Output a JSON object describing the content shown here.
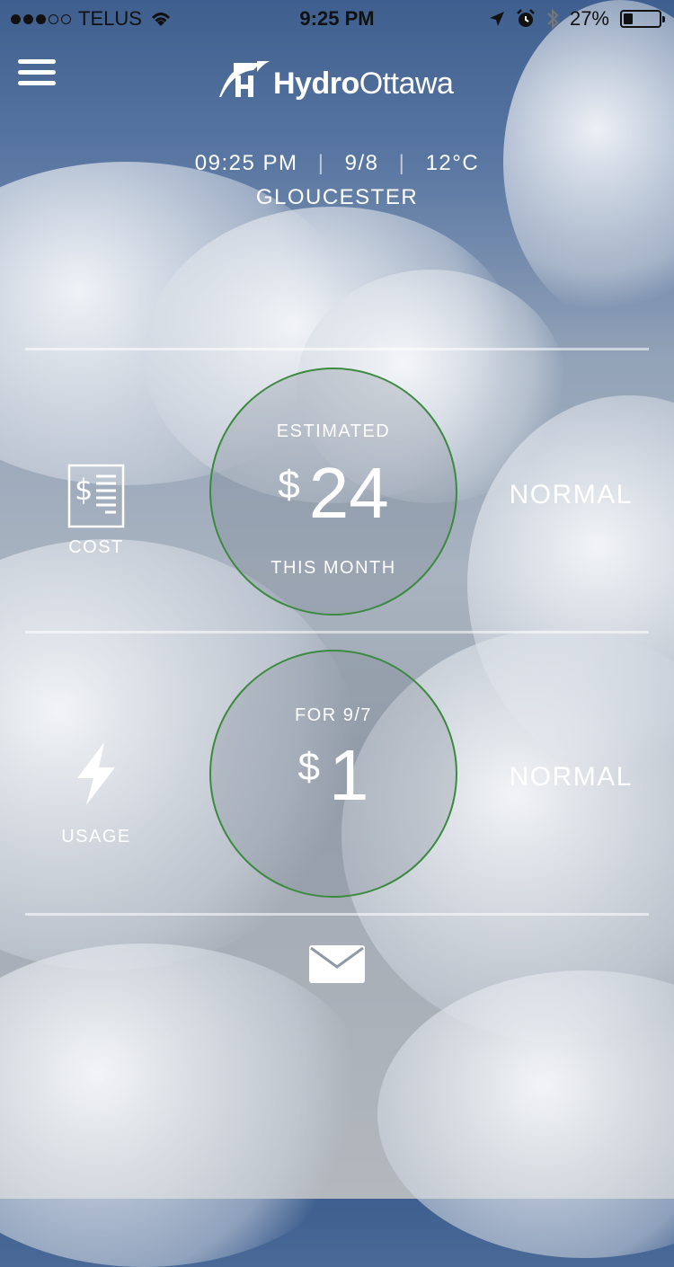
{
  "status_bar": {
    "carrier": "TELUS",
    "time": "9:25 PM",
    "battery": "27%",
    "battery_level": 0.27,
    "signal_bars_filled": 3,
    "signal_bars_total": 5
  },
  "header": {
    "logo_bold": "Hydro",
    "logo_regular": "Ottawa",
    "menu_icon": "hamburger-menu-icon"
  },
  "info": {
    "time": "09:25 PM",
    "date": "9/8",
    "temperature": "12°C",
    "city": "GLOUCESTER"
  },
  "cost": {
    "icon": "bill-icon",
    "label": "COST",
    "top_text": "ESTIMATED",
    "currency": "$",
    "amount": "24",
    "bottom_text": "THIS MONTH",
    "status": "NORMAL"
  },
  "usage": {
    "icon": "lightning-bolt-icon",
    "label": "USAGE",
    "top_text": "FOR 9/7",
    "currency": "$",
    "amount": "1",
    "status": "NORMAL"
  },
  "footer": {
    "mail_icon": "envelope-icon"
  },
  "colors": {
    "circle_border": "#3b8a3f",
    "text": "#ffffff"
  }
}
